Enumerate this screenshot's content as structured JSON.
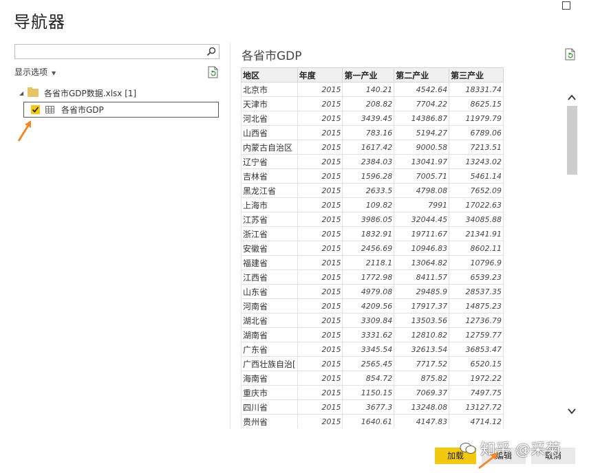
{
  "window": {
    "title": "导航器"
  },
  "search": {
    "placeholder": ""
  },
  "left": {
    "display_options": "显示选项",
    "file_name": "各省市GDP数据.xlsx [1]",
    "sheet_name": "各省市GDP"
  },
  "preview": {
    "title": "各省市GDP",
    "columns": [
      "地区",
      "年度",
      "第一产业",
      "第二产业",
      "第三产业"
    ],
    "rows": [
      [
        "北京市",
        "2015",
        "140.21",
        "4542.64",
        "18331.74"
      ],
      [
        "天津市",
        "2015",
        "208.82",
        "7704.22",
        "8625.15"
      ],
      [
        "河北省",
        "2015",
        "3439.45",
        "14386.87",
        "11979.79"
      ],
      [
        "山西省",
        "2015",
        "783.16",
        "5194.27",
        "6789.06"
      ],
      [
        "内蒙古自治区",
        "2015",
        "1617.42",
        "9000.58",
        "7213.51"
      ],
      [
        "辽宁省",
        "2015",
        "2384.03",
        "13041.97",
        "13243.02"
      ],
      [
        "吉林省",
        "2015",
        "1596.28",
        "7005.71",
        "5461.14"
      ],
      [
        "黑龙江省",
        "2015",
        "2633.5",
        "4798.08",
        "7652.09"
      ],
      [
        "上海市",
        "2015",
        "109.82",
        "7991",
        "17022.63"
      ],
      [
        "江苏省",
        "2015",
        "3986.05",
        "32044.45",
        "34085.88"
      ],
      [
        "浙江省",
        "2015",
        "1832.91",
        "19711.67",
        "21341.91"
      ],
      [
        "安徽省",
        "2015",
        "2456.69",
        "10946.83",
        "8602.11"
      ],
      [
        "福建省",
        "2015",
        "2118.1",
        "13064.82",
        "10796.9"
      ],
      [
        "江西省",
        "2015",
        "1772.98",
        "8411.57",
        "6539.23"
      ],
      [
        "山东省",
        "2015",
        "4979.08",
        "29485.9",
        "28537.35"
      ],
      [
        "河南省",
        "2015",
        "4209.56",
        "17917.37",
        "14875.23"
      ],
      [
        "湖北省",
        "2015",
        "3309.84",
        "13503.56",
        "12736.79"
      ],
      [
        "湖南省",
        "2015",
        "3331.62",
        "12810.82",
        "12759.77"
      ],
      [
        "广东省",
        "2015",
        "3345.54",
        "32613.54",
        "36853.47"
      ],
      [
        "广西壮族自治[",
        "2015",
        "2565.45",
        "7717.52",
        "6520.15"
      ],
      [
        "海南省",
        "2015",
        "854.72",
        "875.82",
        "1972.22"
      ],
      [
        "重庆市",
        "2015",
        "1150.15",
        "7069.37",
        "7497.75"
      ],
      [
        "四川省",
        "2015",
        "3677.3",
        "13248.08",
        "13127.72"
      ],
      [
        "贵州省",
        "2015",
        "1640.61",
        "4147.83",
        "4714.12"
      ]
    ]
  },
  "buttons": {
    "load": "加载",
    "edit": "编辑",
    "cancel": "取消"
  },
  "watermark": "知乎 @采菊",
  "colors": {
    "accent": "#f2c811",
    "arrow": "#f0892c"
  }
}
